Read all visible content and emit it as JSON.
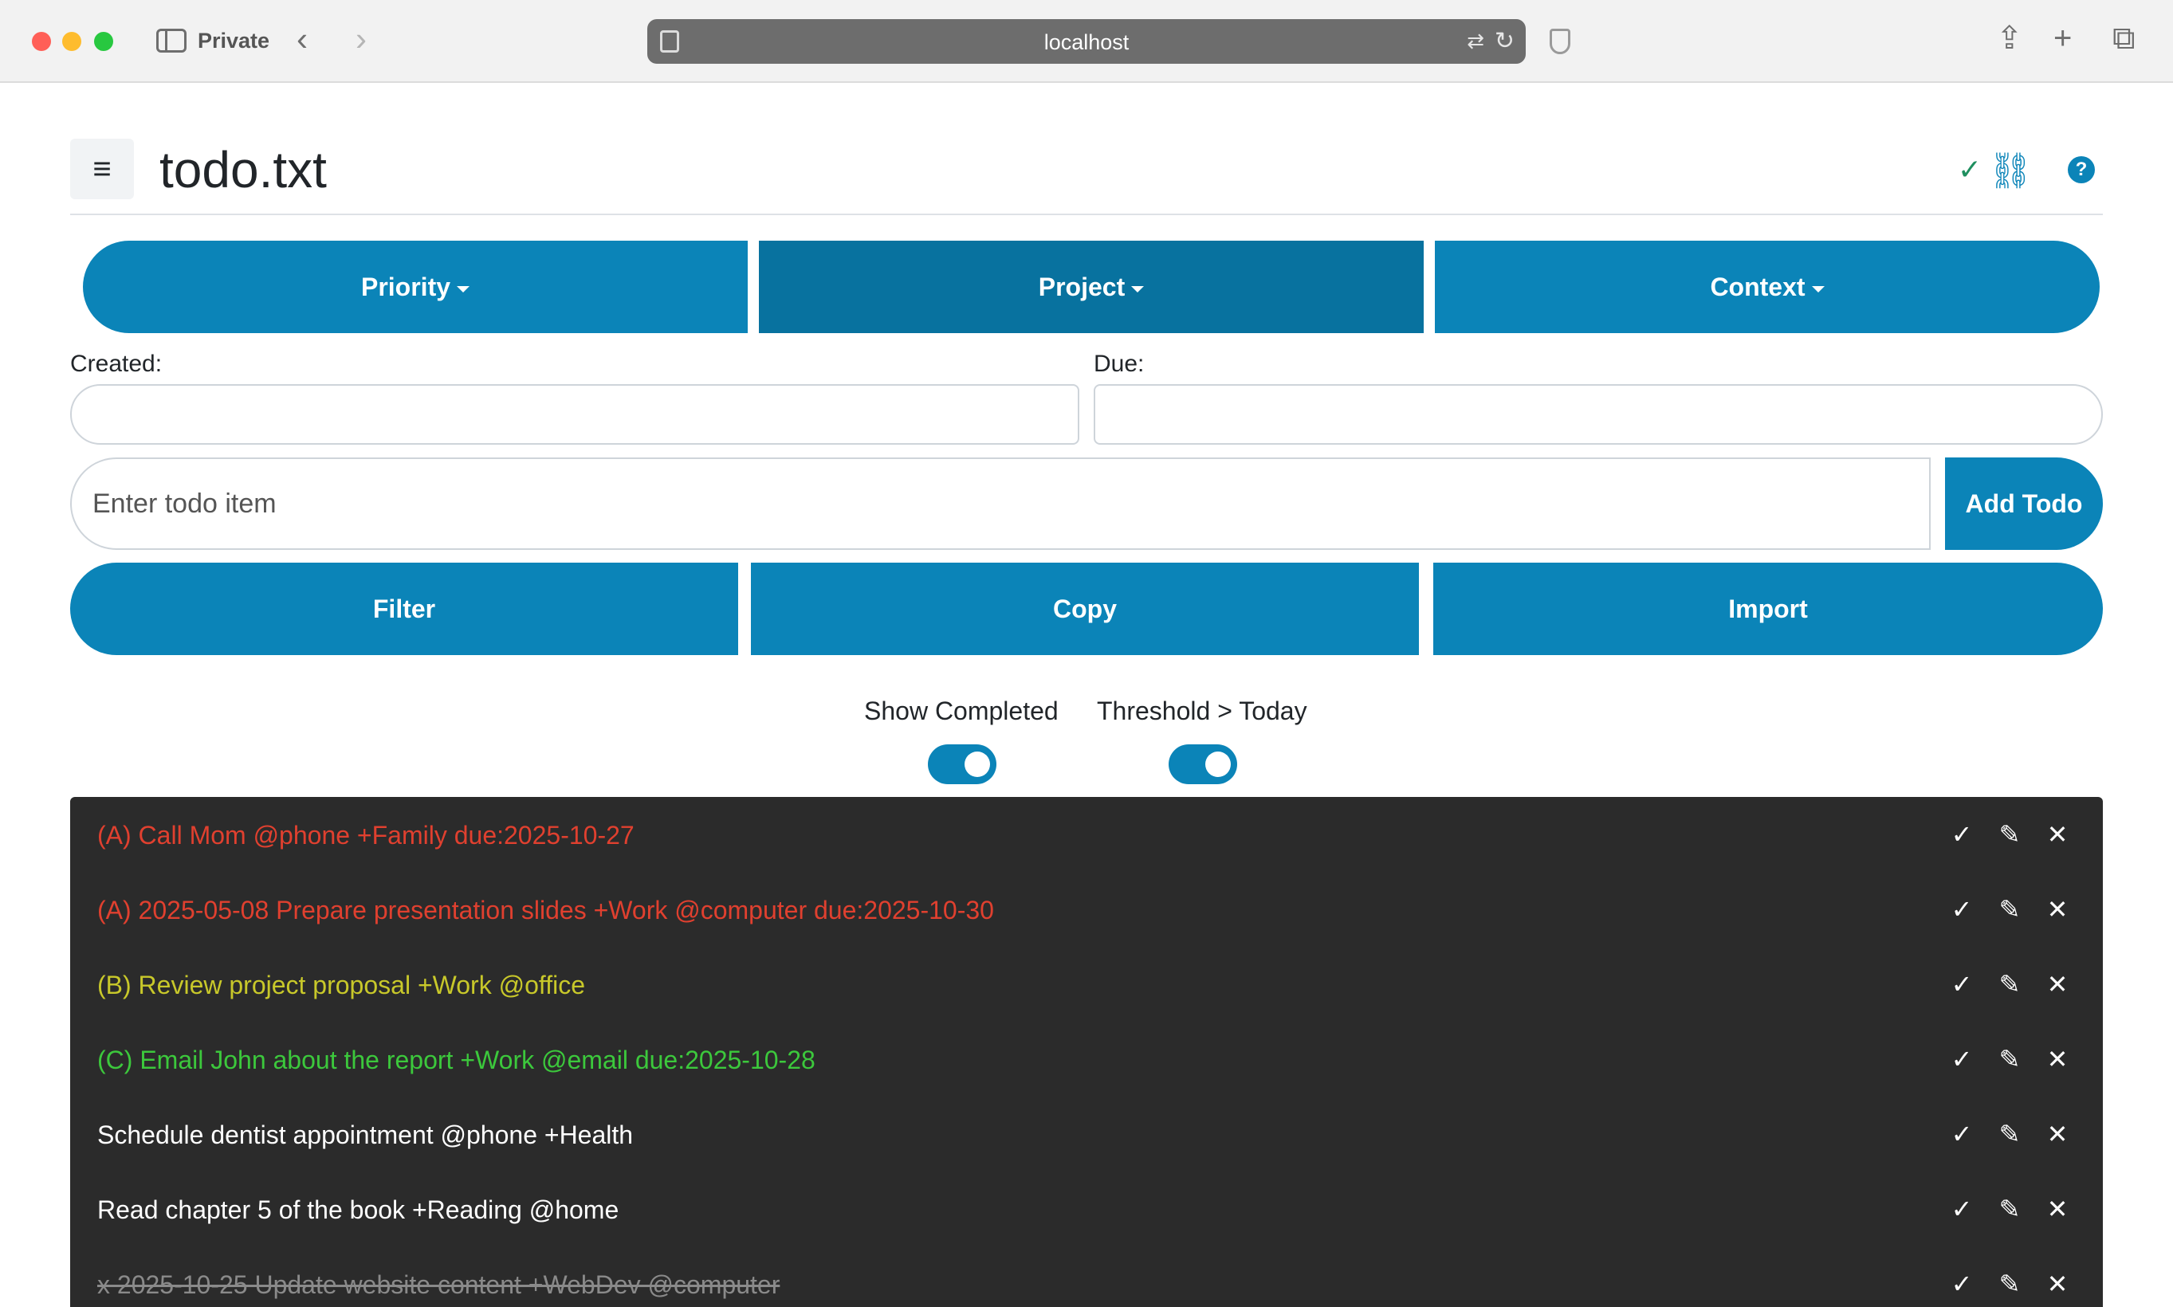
{
  "browser": {
    "private_label": "Private",
    "url": "localhost"
  },
  "header": {
    "menu_glyph": "≡",
    "title": "todo.txt",
    "help_glyph": "?"
  },
  "dropdowns": {
    "priority": "Priority",
    "project": "Project",
    "context": "Context"
  },
  "dates": {
    "created_label": "Created:",
    "due_label": "Due:",
    "created_value": "",
    "due_value": ""
  },
  "new_todo": {
    "placeholder": "Enter todo item",
    "add_label": "Add Todo"
  },
  "actions": {
    "filter": "Filter",
    "copy": "Copy",
    "import": "Import"
  },
  "toggles": {
    "show_completed": {
      "label": "Show Completed",
      "on": true
    },
    "threshold": {
      "label": "Threshold > Today",
      "on": true
    }
  },
  "todos": [
    {
      "text": "(A) Call Mom @phone +Family due:2025-10-27",
      "priority": "A",
      "color": "#e0402f"
    },
    {
      "text": "(A) 2025-05-08 Prepare presentation slides +Work @computer due:2025-10-30",
      "priority": "A",
      "color": "#e0402f"
    },
    {
      "text": "(B) Review project proposal +Work @office",
      "priority": "B",
      "color": "#c8c82a"
    },
    {
      "text": "(C) Email John about the report +Work @email due:2025-10-28",
      "priority": "C",
      "color": "#3cc83c"
    },
    {
      "text": "Schedule dentist appointment @phone +Health",
      "priority": "",
      "color": "#ffffff"
    },
    {
      "text": "Read chapter 5 of the book +Reading @home",
      "priority": "",
      "color": "#ffffff"
    },
    {
      "text": "x 2025-10-25 Update website content +WebDev @computer",
      "priority": "",
      "color": "#8a8a8a",
      "completed": true
    }
  ],
  "todo_action_glyphs": {
    "complete": "✓",
    "edit": "✎",
    "delete": "✕"
  },
  "colors": {
    "accent": "#0b84b8",
    "accent_active": "#08729f",
    "list_bg": "#2b2b2b"
  }
}
